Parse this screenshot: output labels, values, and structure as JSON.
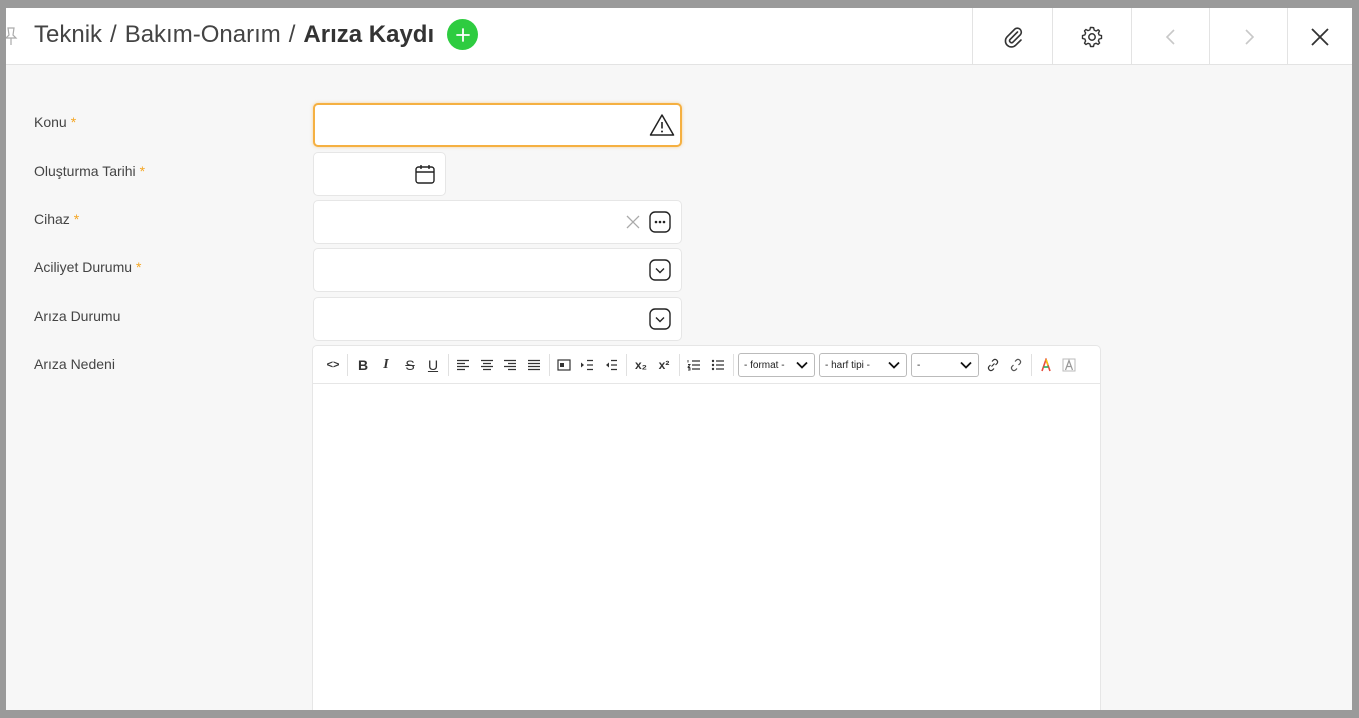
{
  "header": {
    "breadcrumb": [
      "Teknik",
      "Bakım-Onarım"
    ],
    "separator": "/",
    "current": "Arıza Kaydı",
    "add_icon": "plus-circle-icon",
    "actions": [
      {
        "name": "attachment-button",
        "icon": "paperclip-icon"
      },
      {
        "name": "settings-button",
        "icon": "gear-icon"
      },
      {
        "name": "previous-button",
        "icon": "chevron-left-icon"
      },
      {
        "name": "next-button",
        "icon": "chevron-right-icon"
      },
      {
        "name": "close-button",
        "icon": "close-icon"
      }
    ]
  },
  "form": {
    "required_mark": "*",
    "fields": {
      "konu": {
        "label": "Konu",
        "required": true,
        "value": "",
        "icon": "warning-icon"
      },
      "olusturma_tarihi": {
        "label": "Oluşturma Tarihi",
        "required": true,
        "value": "",
        "icon": "calendar-icon"
      },
      "cihaz": {
        "label": "Cihaz",
        "required": true,
        "value": "",
        "icons": [
          "clear-icon",
          "more-icon"
        ]
      },
      "aciliyet_durumu": {
        "label": "Aciliyet Durumu",
        "required": true,
        "value": "",
        "icon": "chevron-down-icon"
      },
      "ariza_durumu": {
        "label": "Arıza Durumu",
        "required": false,
        "value": "",
        "icon": "chevron-down-icon"
      },
      "ariza_nedeni": {
        "label": "Arıza Nedeni",
        "required": false,
        "value": ""
      }
    }
  },
  "editor": {
    "format_select": "- format -",
    "font_select": "- harf tipi -",
    "size_select": "-",
    "bold": "B",
    "italic": "I",
    "strike": "S",
    "underline": "U",
    "code": "<>",
    "subscript": "x₂",
    "superscript": "x²"
  },
  "colors": {
    "accent_green": "#2ecc40",
    "required": "#f5a623",
    "focus": "#f5b041"
  }
}
